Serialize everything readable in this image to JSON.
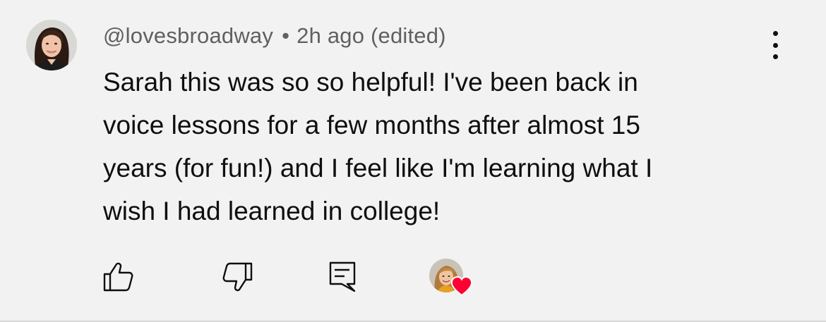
{
  "comment": {
    "author_handle": "@lovesbroadway",
    "separator": "•",
    "timestamp": "2h ago",
    "edited_label": "(edited)",
    "text_lines": [
      "Sarah this was so so helpful! I've been back in",
      "voice lessons for a few months after almost 15",
      "years (for fun!) and I feel like I'm learning what I",
      "wish I had learned in college!"
    ],
    "creator_hearted": true
  },
  "actions": {
    "like_icon": "thumb-up-icon",
    "dislike_icon": "thumb-down-icon",
    "reply_icon": "reply-comment-icon",
    "more_icon": "more-vertical-icon"
  },
  "colors": {
    "background": "#f2f2f2",
    "text_primary": "#0f0f0f",
    "text_secondary": "#606060",
    "heart": "#ff0033"
  }
}
